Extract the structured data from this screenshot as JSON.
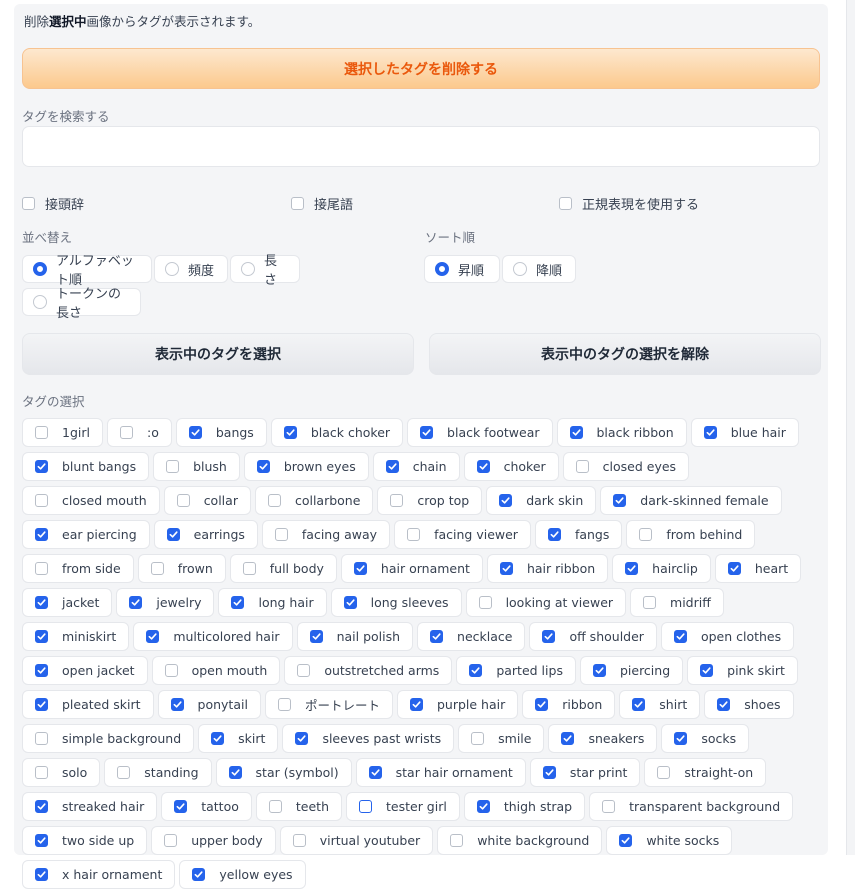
{
  "info": {
    "prefix": "削除",
    "bold": "選択中",
    "suffix": "画像からタグが表示されます。"
  },
  "delete_button": "選択したタグを削除する",
  "search": {
    "label": "タグを検索する",
    "value": "",
    "placeholder": ""
  },
  "match_options": [
    {
      "label": "接頭辞",
      "checked": false
    },
    {
      "label": "接尾語",
      "checked": false
    },
    {
      "label": "正規表現を使用する",
      "checked": false
    }
  ],
  "sort_by": {
    "label": "並べ替え",
    "options": [
      {
        "label": "アルファベット順",
        "selected": true
      },
      {
        "label": "頻度",
        "selected": false
      },
      {
        "label": "長さ",
        "selected": false
      },
      {
        "label": "トークンの長さ",
        "selected": false
      }
    ]
  },
  "sort_order": {
    "label": "ソート順",
    "options": [
      {
        "label": "昇順",
        "selected": true
      },
      {
        "label": "降順",
        "selected": false
      }
    ]
  },
  "buttons": {
    "select_shown": "表示中のタグを選択",
    "deselect_shown": "表示中のタグの選択を解除"
  },
  "tag_selection": {
    "label": "タグの選択",
    "tags": [
      {
        "label": "1girl",
        "checked": false
      },
      {
        "label": ":o",
        "checked": false
      },
      {
        "label": "bangs",
        "checked": true
      },
      {
        "label": "black choker",
        "checked": true
      },
      {
        "label": "black footwear",
        "checked": true
      },
      {
        "label": "black ribbon",
        "checked": true
      },
      {
        "label": "blue hair",
        "checked": true
      },
      {
        "label": "blunt bangs",
        "checked": true
      },
      {
        "label": "blush",
        "checked": false
      },
      {
        "label": "brown eyes",
        "checked": true
      },
      {
        "label": "chain",
        "checked": true
      },
      {
        "label": "choker",
        "checked": true
      },
      {
        "label": "closed eyes",
        "checked": false
      },
      {
        "label": "closed mouth",
        "checked": false
      },
      {
        "label": "collar",
        "checked": false
      },
      {
        "label": "collarbone",
        "checked": false
      },
      {
        "label": "crop top",
        "checked": false
      },
      {
        "label": "dark skin",
        "checked": true
      },
      {
        "label": "dark-skinned female",
        "checked": true
      },
      {
        "label": "ear piercing",
        "checked": true
      },
      {
        "label": "earrings",
        "checked": true
      },
      {
        "label": "facing away",
        "checked": false
      },
      {
        "label": "facing viewer",
        "checked": false
      },
      {
        "label": "fangs",
        "checked": true
      },
      {
        "label": "from behind",
        "checked": false
      },
      {
        "label": "from side",
        "checked": false
      },
      {
        "label": "frown",
        "checked": false
      },
      {
        "label": "full body",
        "checked": false
      },
      {
        "label": "hair ornament",
        "checked": true
      },
      {
        "label": "hair ribbon",
        "checked": true
      },
      {
        "label": "hairclip",
        "checked": true
      },
      {
        "label": "heart",
        "checked": true
      },
      {
        "label": "jacket",
        "checked": true
      },
      {
        "label": "jewelry",
        "checked": true
      },
      {
        "label": "long hair",
        "checked": true
      },
      {
        "label": "long sleeves",
        "checked": true
      },
      {
        "label": "looking at viewer",
        "checked": false
      },
      {
        "label": "midriff",
        "checked": false
      },
      {
        "label": "miniskirt",
        "checked": true
      },
      {
        "label": "multicolored hair",
        "checked": true
      },
      {
        "label": "nail polish",
        "checked": true
      },
      {
        "label": "necklace",
        "checked": true
      },
      {
        "label": "off shoulder",
        "checked": true
      },
      {
        "label": "open clothes",
        "checked": true
      },
      {
        "label": "open jacket",
        "checked": true
      },
      {
        "label": "open mouth",
        "checked": false
      },
      {
        "label": "outstretched arms",
        "checked": false
      },
      {
        "label": "parted lips",
        "checked": true
      },
      {
        "label": "piercing",
        "checked": true
      },
      {
        "label": "pink skirt",
        "checked": true
      },
      {
        "label": "pleated skirt",
        "checked": true
      },
      {
        "label": "ponytail",
        "checked": true
      },
      {
        "label": "ポートレート",
        "checked": false
      },
      {
        "label": "purple hair",
        "checked": true
      },
      {
        "label": "ribbon",
        "checked": true
      },
      {
        "label": "shirt",
        "checked": true
      },
      {
        "label": "shoes",
        "checked": true
      },
      {
        "label": "simple background",
        "checked": false
      },
      {
        "label": "skirt",
        "checked": true
      },
      {
        "label": "sleeves past wrists",
        "checked": true
      },
      {
        "label": "smile",
        "checked": false
      },
      {
        "label": "sneakers",
        "checked": true
      },
      {
        "label": "socks",
        "checked": true
      },
      {
        "label": "solo",
        "checked": false
      },
      {
        "label": "standing",
        "checked": false
      },
      {
        "label": "star (symbol)",
        "checked": true
      },
      {
        "label": "star hair ornament",
        "checked": true
      },
      {
        "label": "star print",
        "checked": true
      },
      {
        "label": "straight-on",
        "checked": false
      },
      {
        "label": "streaked hair",
        "checked": true
      },
      {
        "label": "tattoo",
        "checked": true
      },
      {
        "label": "teeth",
        "checked": false
      },
      {
        "label": "tester girl",
        "checked": false,
        "focused": true
      },
      {
        "label": "thigh strap",
        "checked": true
      },
      {
        "label": "transparent background",
        "checked": false
      },
      {
        "label": "two side up",
        "checked": true
      },
      {
        "label": "upper body",
        "checked": false
      },
      {
        "label": "virtual youtuber",
        "checked": false
      },
      {
        "label": "white background",
        "checked": false
      },
      {
        "label": "white socks",
        "checked": true
      },
      {
        "label": "x hair ornament",
        "checked": true
      },
      {
        "label": "yellow eyes",
        "checked": true
      }
    ]
  },
  "colors": {
    "accent": "#2563eb",
    "primary_text": "#ea580c"
  }
}
